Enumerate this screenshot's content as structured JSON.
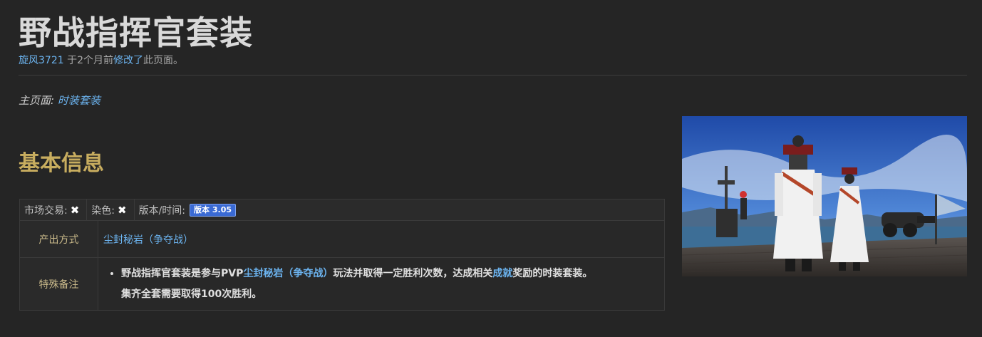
{
  "page": {
    "title": "野战指挥官套装",
    "edit_user": "旋风3721",
    "edit_time_text": " 于2个月前",
    "edit_link": "修改了",
    "edit_suffix": "此页面。",
    "main_page_label": "主页面: ",
    "main_page_link": "时装套装"
  },
  "section": {
    "heading": "基本信息"
  },
  "table": {
    "market_label": "市场交易:",
    "market_value_icon": "cross-icon",
    "dye_label": "染色:",
    "dye_value_icon": "cross-icon",
    "version_label": "版本/时间:",
    "version_badge": "版本 3.05",
    "output_label": "产出方式",
    "output_value": "尘封秘岩（争夺战）",
    "note_label": "特殊备注",
    "note_part1": "野战指挥官套装是参与PVP",
    "note_link1": "尘封秘岩（争夺战）",
    "note_part2": "玩法并取得一定胜利次数，达成相关",
    "note_link2": "成就",
    "note_part3": "奖励的时装套装。",
    "note_line2": "集齐全套需要取得100次胜利。"
  },
  "colors": {
    "background": "#252525",
    "link": "#6cb4f0",
    "heading_gold": "#c8ad5f",
    "badge_blue": "#3a6ad4"
  }
}
